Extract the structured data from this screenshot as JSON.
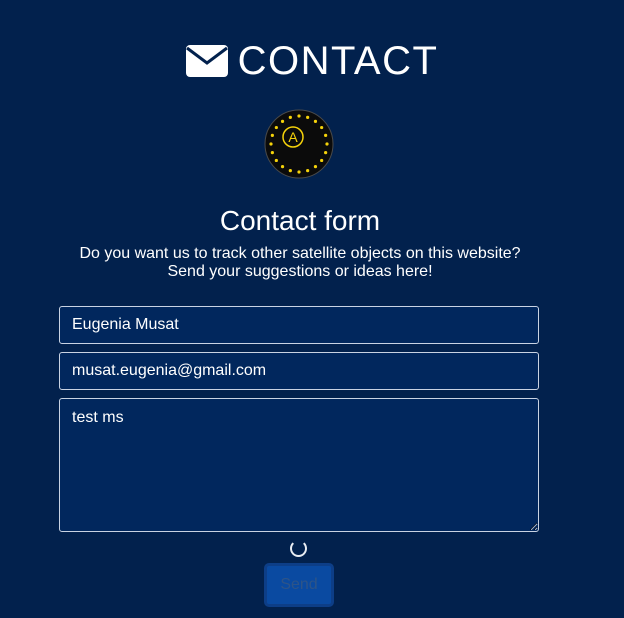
{
  "header": {
    "icon": "envelope-icon",
    "title": "CONTACT"
  },
  "logo": {
    "letter": "A",
    "icon": "moon-stars-badge"
  },
  "form": {
    "title": "Contact form",
    "description_line1": "Do you want us to track other satellite objects on this website?",
    "description_line2": "Send your suggestions or ideas here!",
    "name_value": "Eugenia Musat",
    "email_value": "musat.eugenia@gmail.com",
    "message_value": "test ms",
    "send_label": "Send",
    "loading_icon": "spinner-icon"
  },
  "colors": {
    "background": "#02214d",
    "field_background": "#01275d",
    "button_background": "#0a4aa1",
    "moon": "#f5d20a"
  }
}
